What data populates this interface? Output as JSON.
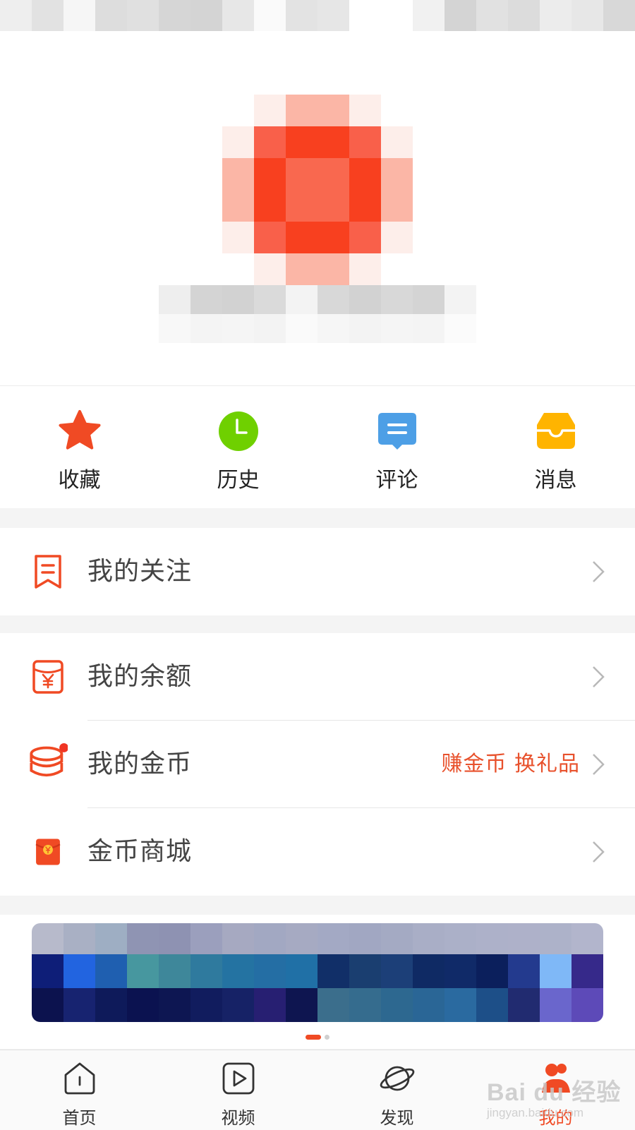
{
  "colors": {
    "accent": "#f04a24",
    "accent_text": "#e8512c",
    "favorite_icon": "#f04a24",
    "history_icon": "#6fd000",
    "comment_icon": "#4d9fe6",
    "message_icon": "#ffb400",
    "badge_dot": "#f03524"
  },
  "profile": {
    "avatar": "profile-avatar (pixelated)",
    "username": "pixelated user name"
  },
  "quick_actions": [
    {
      "label": "收藏",
      "icon": "star-icon"
    },
    {
      "label": "历史",
      "icon": "clock-icon"
    },
    {
      "label": "评论",
      "icon": "comment-icon"
    },
    {
      "label": "消息",
      "icon": "inbox-icon"
    }
  ],
  "menu": {
    "follow": {
      "label": "我的关注",
      "icon": "bookmark-icon"
    },
    "balance": {
      "label": "我的余额",
      "icon": "yuan-wallet-icon"
    },
    "coins": {
      "label": "我的金币",
      "icon": "coin-stack-icon",
      "promo": "赚金币 换礼品"
    },
    "mall": {
      "label": "金币商城",
      "icon": "red-envelope-icon"
    }
  },
  "banner": {
    "content": "pixelated promotional banner",
    "page_count": 2,
    "active_page": 1
  },
  "tabbar": [
    {
      "label": "首页",
      "icon": "home-icon"
    },
    {
      "label": "视频",
      "icon": "video-play-icon"
    },
    {
      "label": "发现",
      "icon": "planet-icon"
    },
    {
      "label": "我的",
      "icon": "profile-icon",
      "active": true
    }
  ],
  "watermark": {
    "line1": "Bai du 经验",
    "line2": "jingyan.baidu.com"
  }
}
